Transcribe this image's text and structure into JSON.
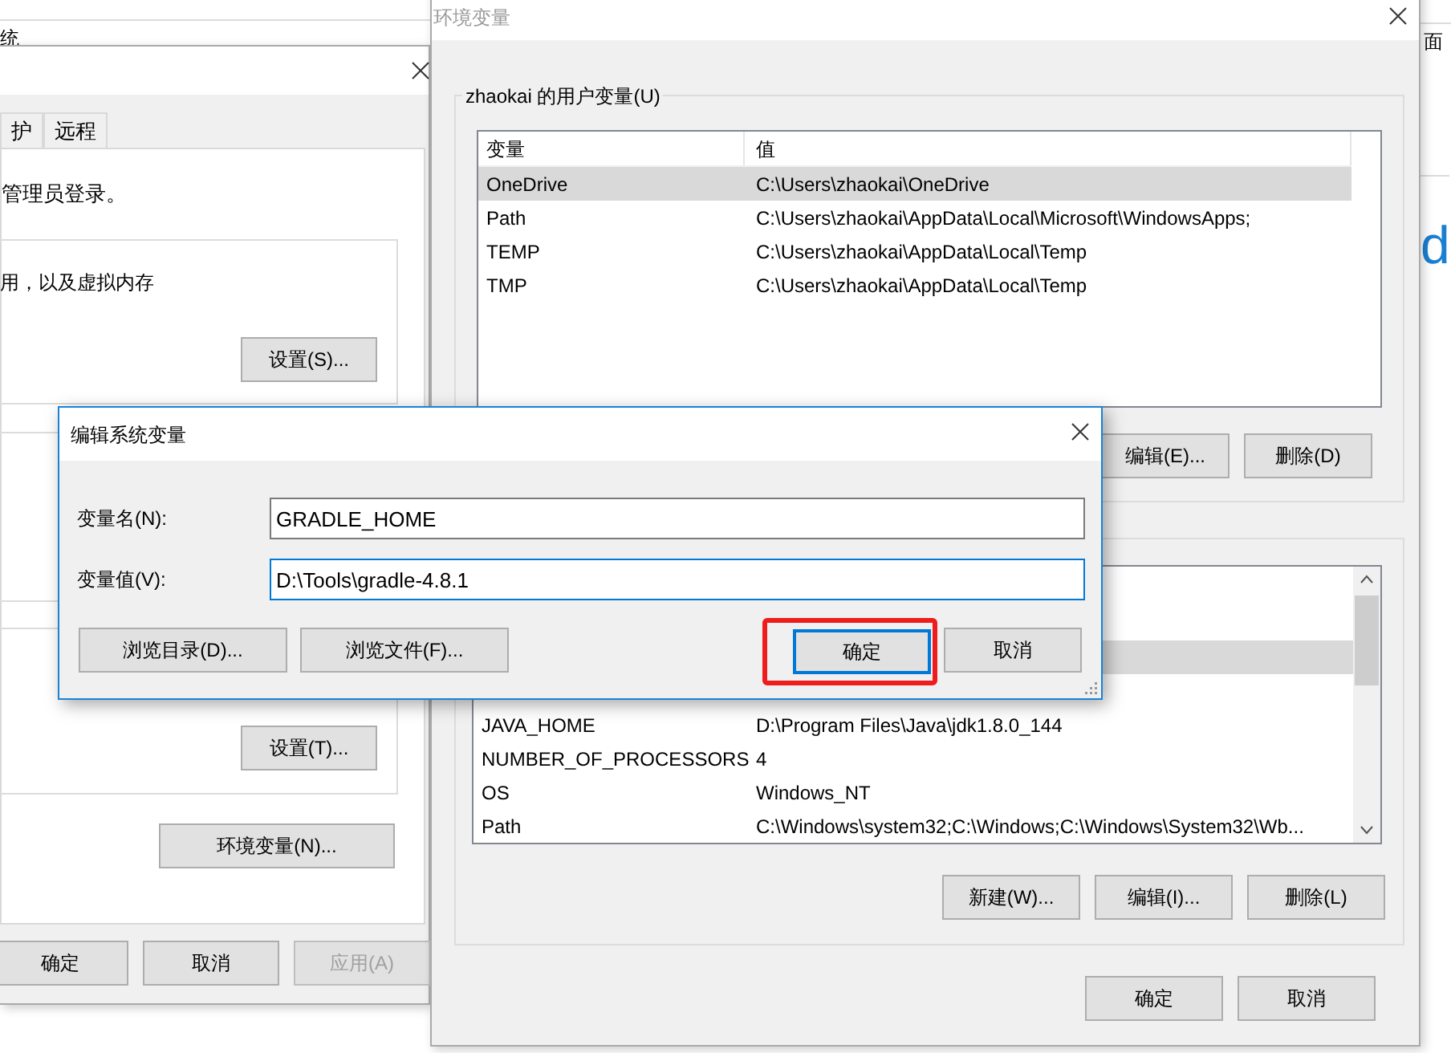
{
  "background": {
    "left_window_title": "统",
    "right_window_label": "面",
    "right_logo_text": "d"
  },
  "system_properties": {
    "tabs": [
      {
        "label": "护",
        "selected": false
      },
      {
        "label": "远程",
        "selected": false
      }
    ],
    "admin_note": "管理员登录。",
    "performance_text": "用，以及虚拟内存",
    "performance_button": "设置(S)...",
    "startup_button": "设置(T)...",
    "env_button": "环境变量(N)...",
    "footer_buttons": [
      {
        "label": "确定",
        "disabled": false
      },
      {
        "label": "取消",
        "disabled": false
      },
      {
        "label": "应用(A)",
        "disabled": true
      }
    ]
  },
  "environment_variables": {
    "title": "环境变量",
    "active": false,
    "user_group_label": "zhaokai 的用户变量(U)",
    "user_columns": [
      "变量",
      "值"
    ],
    "user_rows": [
      {
        "name": "OneDrive",
        "value": "C:\\Users\\zhaokai\\OneDrive",
        "selected": true
      },
      {
        "name": "Path",
        "value": "C:\\Users\\zhaokai\\AppData\\Local\\Microsoft\\WindowsApps;",
        "selected": false
      },
      {
        "name": "TEMP",
        "value": "C:\\Users\\zhaokai\\AppData\\Local\\Temp",
        "selected": false
      },
      {
        "name": "TMP",
        "value": "C:\\Users\\zhaokai\\AppData\\Local\\Temp",
        "selected": false
      }
    ],
    "user_buttons": [
      "编辑(E)...",
      "删除(D)"
    ],
    "system_rows": [
      {
        "selected": false
      },
      {
        "selected": false
      },
      {
        "selected": true
      },
      {
        "selected": false
      },
      {
        "name": "JAVA_HOME",
        "value": "D:\\Program Files\\Java\\jdk1.8.0_144",
        "selected": false
      },
      {
        "name": "NUMBER_OF_PROCESSORS",
        "value": "4",
        "selected": false
      },
      {
        "name": "OS",
        "value": "Windows_NT",
        "selected": false
      },
      {
        "name": "Path",
        "value": "C:\\Windows\\system32;C:\\Windows;C:\\Windows\\System32\\Wb...",
        "selected": false
      }
    ],
    "system_buttons": [
      "新建(W)...",
      "编辑(I)...",
      "删除(L)"
    ],
    "footer_buttons": [
      "确定",
      "取消"
    ]
  },
  "edit_dialog": {
    "title": "编辑系统变量",
    "active": true,
    "fields": [
      {
        "label": "变量名(N):",
        "value": "GRADLE_HOME",
        "focused": false
      },
      {
        "label": "变量值(V):",
        "value": "D:\\Tools\\gradle-4.8.1",
        "focused": true
      }
    ],
    "buttons": [
      {
        "label": "浏览目录(D)...",
        "kind": "browse",
        "annotated": false
      },
      {
        "label": "浏览文件(F)...",
        "kind": "browse",
        "annotated": false
      },
      {
        "label": "确定",
        "kind": "default",
        "annotated": true
      },
      {
        "label": "取消",
        "kind": "plain",
        "annotated": false
      }
    ]
  }
}
